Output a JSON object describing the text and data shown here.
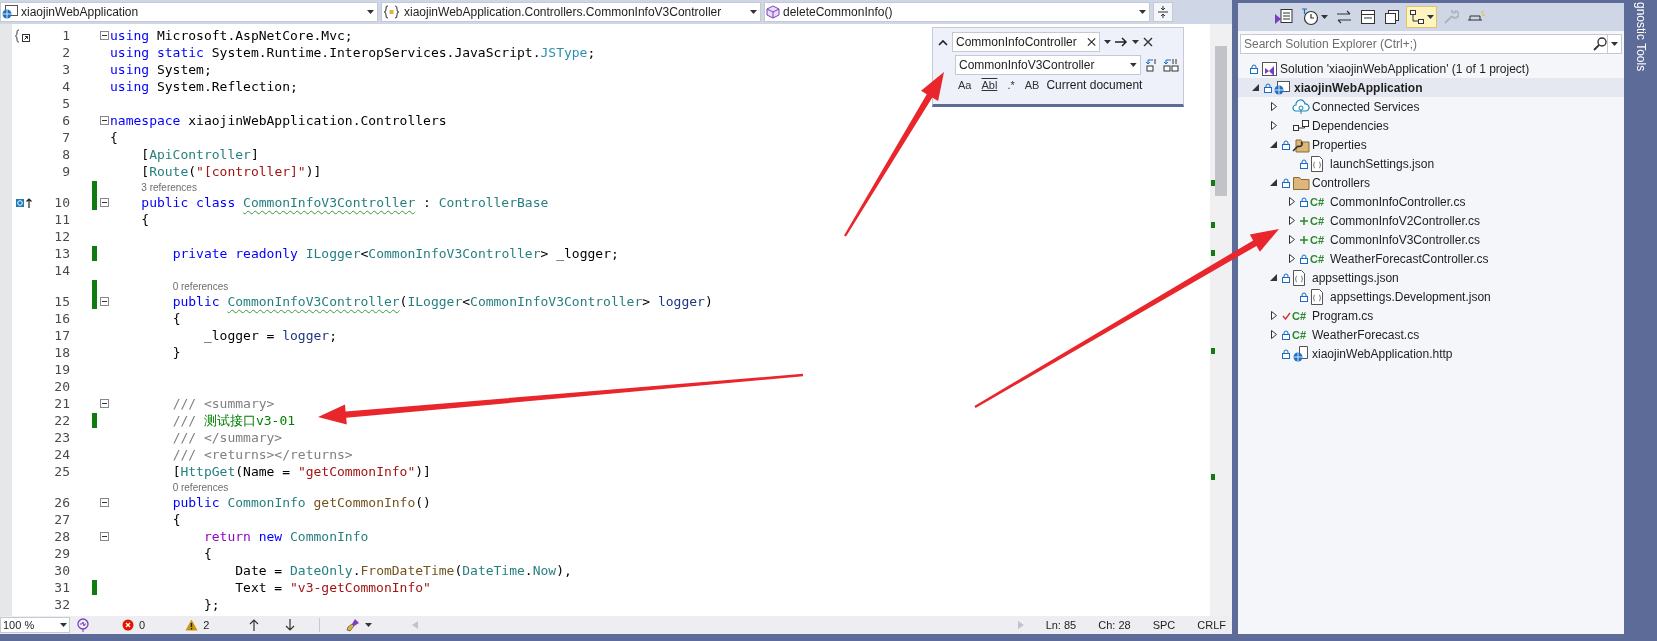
{
  "nav": [
    {
      "kind": "project",
      "text": "xiaojinWebApplication"
    },
    {
      "kind": "namespace",
      "text": "xiaojinWebApplication.Controllers.CommonInfoV3Controller"
    },
    {
      "kind": "method",
      "text": "deleteCommonInfo()"
    }
  ],
  "editor": {
    "lines": [
      {
        "number": "1",
        "kind": "scope",
        "fold": true,
        "changed": false,
        "tokens": [
          {
            "text": "using",
            "kind": "kw"
          },
          {
            "text": " Microsoft.AspNetCore.Mvc;"
          }
        ]
      },
      {
        "number": "2",
        "kind": "code",
        "fold": false,
        "changed": false,
        "tokens": [
          {
            "text": "using",
            "kind": "kw"
          },
          {
            "text": " static",
            "kind": "kw"
          },
          {
            "text": " System.Runtime.InteropServices.JavaScript."
          },
          {
            "text": "JSType",
            "kind": "type2"
          },
          {
            "text": ";"
          }
        ]
      },
      {
        "number": "3",
        "kind": "code",
        "fold": false,
        "changed": false,
        "tokens": [
          {
            "text": "using",
            "kind": "kw"
          },
          {
            "text": " System;"
          }
        ]
      },
      {
        "number": "4",
        "kind": "code",
        "fold": false,
        "changed": false,
        "tokens": [
          {
            "text": "using",
            "kind": "kw"
          },
          {
            "text": " System.Reflection;"
          }
        ]
      },
      {
        "number": "5",
        "kind": "code",
        "fold": false,
        "changed": false
      },
      {
        "number": "6",
        "kind": "code",
        "fold": true,
        "changed": false,
        "tokens": [
          {
            "text": "namespace",
            "kind": "kw"
          },
          {
            "text": " xiaojinWebApplication.Controllers"
          }
        ]
      },
      {
        "number": "7",
        "kind": "code",
        "fold": false,
        "changed": false,
        "tokens": [
          {
            "text": "{"
          }
        ]
      },
      {
        "number": "8",
        "kind": "code",
        "fold": false,
        "changed": false,
        "tokens": [
          {
            "text": "    ["
          },
          {
            "text": "ApiController",
            "kind": "type"
          },
          {
            "text": "]"
          }
        ]
      },
      {
        "number": "9",
        "kind": "code",
        "fold": false,
        "changed": false,
        "tokens": [
          {
            "text": "    ["
          },
          {
            "text": "Route",
            "kind": "type"
          },
          {
            "text": "("
          },
          {
            "text": "\"[controller]\"",
            "kind": "str"
          },
          {
            "text": ")]"
          }
        ]
      },
      {
        "number": "10",
        "kind": "implements",
        "lens": "3 references",
        "fold": true,
        "changed": true,
        "tokens": [
          {
            "text": "    public",
            "kind": "kw"
          },
          {
            "text": " class ",
            "kind": "kw"
          },
          {
            "text": "CommonInfoV3Controller",
            "kind": "type",
            "squiggle": true
          },
          {
            "text": " : "
          },
          {
            "text": "ControllerBase",
            "kind": "type"
          }
        ]
      },
      {
        "number": "11",
        "kind": "code",
        "fold": false,
        "changed": false,
        "tokens": [
          {
            "text": "    {"
          }
        ]
      },
      {
        "number": "12",
        "kind": "code",
        "fold": false,
        "changed": false
      },
      {
        "number": "13",
        "kind": "code",
        "fold": false,
        "changed": true,
        "tokens": [
          {
            "text": "        private",
            "kind": "kw"
          },
          {
            "text": " readonly",
            "kind": "kw"
          },
          {
            "text": " ILogger",
            "kind": "type"
          },
          {
            "text": "<"
          },
          {
            "text": "CommonInfoV3Controller",
            "kind": "type"
          },
          {
            "text": "> _logger;"
          }
        ]
      },
      {
        "number": "14",
        "kind": "code",
        "fold": false,
        "changed": false
      },
      {
        "number": "15",
        "kind": "code",
        "lens": "0 references",
        "fold": true,
        "changed": true,
        "tokens": [
          {
            "text": "        public ",
            "kind": "kw"
          },
          {
            "text": "CommonInfoV3Controller",
            "kind": "type",
            "squiggle": true
          },
          {
            "text": "("
          },
          {
            "text": "ILogger",
            "kind": "type"
          },
          {
            "text": "<"
          },
          {
            "text": "CommonInfoV3Controller",
            "kind": "type"
          },
          {
            "text": "> "
          },
          {
            "text": "logger",
            "kind": "param"
          },
          {
            "text": ")"
          }
        ]
      },
      {
        "number": "16",
        "kind": "code",
        "fold": false,
        "changed": false,
        "tokens": [
          {
            "text": "        {"
          }
        ]
      },
      {
        "number": "17",
        "kind": "code",
        "fold": false,
        "changed": false,
        "tokens": [
          {
            "text": "            _logger = "
          },
          {
            "text": "logger",
            "kind": "param"
          },
          {
            "text": ";"
          }
        ]
      },
      {
        "number": "18",
        "kind": "code",
        "fold": false,
        "changed": false,
        "tokens": [
          {
            "text": "        }"
          }
        ]
      },
      {
        "number": "19",
        "kind": "code",
        "fold": false,
        "changed": false
      },
      {
        "number": "20",
        "kind": "code",
        "fold": false,
        "changed": false
      },
      {
        "number": "21",
        "kind": "code",
        "fold": true,
        "changed": false,
        "tokens": [
          {
            "text": "        /// <summary>",
            "kind": "doc"
          }
        ]
      },
      {
        "number": "22",
        "kind": "code",
        "fold": false,
        "changed": true,
        "tokens": [
          {
            "text": "        ///",
            "kind": "doc"
          },
          {
            "text": " 测试接口v3-01",
            "kind": "com"
          }
        ]
      },
      {
        "number": "23",
        "kind": "code",
        "fold": false,
        "changed": false,
        "tokens": [
          {
            "text": "        /// </summary>",
            "kind": "doc"
          }
        ]
      },
      {
        "number": "24",
        "kind": "code",
        "fold": false,
        "changed": false,
        "tokens": [
          {
            "text": "        /// <returns></returns>",
            "kind": "doc"
          }
        ]
      },
      {
        "number": "25",
        "kind": "code",
        "fold": false,
        "changed": false,
        "tokens": [
          {
            "text": "        ["
          },
          {
            "text": "HttpGet",
            "kind": "type"
          },
          {
            "text": "(Name = "
          },
          {
            "text": "\"getCommonInfo\"",
            "kind": "str"
          },
          {
            "text": ")]"
          }
        ]
      },
      {
        "number": "26",
        "kind": "code",
        "lens": "0 references",
        "fold": true,
        "changed": false,
        "tokens": [
          {
            "text": "        public",
            "kind": "kw"
          },
          {
            "text": " CommonInfo",
            "kind": "type"
          },
          {
            "text": " getCommonInfo",
            "kind": "method"
          },
          {
            "text": "()"
          }
        ]
      },
      {
        "number": "27",
        "kind": "code",
        "fold": false,
        "changed": false,
        "tokens": [
          {
            "text": "        {"
          }
        ]
      },
      {
        "number": "28",
        "kind": "code",
        "fold": true,
        "changed": false,
        "tokens": [
          {
            "text": "            return",
            "kind": "ctl"
          },
          {
            "text": " new",
            "kind": "kw"
          },
          {
            "text": " CommonInfo",
            "kind": "type"
          }
        ]
      },
      {
        "number": "29",
        "kind": "code",
        "fold": false,
        "changed": false,
        "tokens": [
          {
            "text": "            {"
          }
        ]
      },
      {
        "number": "30",
        "kind": "code",
        "fold": false,
        "changed": false,
        "tokens": [
          {
            "text": "                Date = "
          },
          {
            "text": "DateOnly",
            "kind": "type"
          },
          {
            "text": "."
          },
          {
            "text": "FromDateTime",
            "kind": "method"
          },
          {
            "text": "("
          },
          {
            "text": "DateTime",
            "kind": "type"
          },
          {
            "text": "."
          },
          {
            "text": "Now",
            "kind": "type"
          },
          {
            "text": "),"
          }
        ]
      },
      {
        "number": "31",
        "kind": "code",
        "fold": false,
        "changed": true,
        "tokens": [
          {
            "text": "                Text = "
          },
          {
            "text": "\"v3-getCommonInfo\"",
            "kind": "str"
          }
        ]
      },
      {
        "number": "32",
        "kind": "code",
        "fold": false,
        "changed": false,
        "tokens": [
          {
            "text": "            };"
          }
        ]
      }
    ]
  },
  "find_widget": {
    "find": {
      "value": "CommonInfoController"
    },
    "replace": {
      "value": "CommonInfoV3Controller"
    },
    "options": [
      {
        "label": "Aa",
        "selected": false
      },
      {
        "label": "Abl",
        "selected": false
      },
      {
        "label": ".*",
        "selected": false
      },
      {
        "label": "AB",
        "selected": false
      }
    ],
    "scope": "Current document"
  },
  "status_bar": {
    "zoom": "100 %",
    "errors": "0",
    "warnings": "2",
    "line": "Ln: 85",
    "column": "Ch: 28",
    "indent": "SPC",
    "line_ending": "CRLF"
  },
  "solution_explorer": {
    "toolbar": [
      {
        "kind": "switch-views",
        "selected": false,
        "disabled": false
      },
      {
        "kind": "history",
        "dropdown": true,
        "selected": false,
        "disabled": false
      },
      {
        "kind": "sync",
        "selected": false,
        "disabled": false
      },
      {
        "kind": "collapse",
        "selected": false,
        "disabled": false
      },
      {
        "kind": "show-all",
        "selected": false,
        "disabled": false
      },
      {
        "kind": "preview",
        "dropdown": true,
        "selected": true,
        "disabled": false
      },
      {
        "kind": "properties",
        "selected": false,
        "disabled": true
      },
      {
        "kind": "pending",
        "selected": false,
        "disabled": false
      }
    ],
    "search": {
      "placeholder": "Search Solution Explorer (Ctrl+;)"
    },
    "tree": [
      {
        "label": "Solution 'xiaojinWebApplication' (1 of 1 project)",
        "kind": "solution",
        "locked": true,
        "added": false,
        "modified": false,
        "selected": false,
        "children": [
          {
            "label": "xiaojinWebApplication",
            "kind": "project",
            "locked": true,
            "added": false,
            "modified": false,
            "expanded": true,
            "selected": true,
            "children": [
              {
                "label": "Connected Services",
                "kind": "connected",
                "locked": false,
                "added": false,
                "modified": false,
                "expanded": false,
                "selected": false
              },
              {
                "label": "Dependencies",
                "kind": "dependencies",
                "locked": false,
                "added": false,
                "modified": false,
                "expanded": false,
                "selected": false
              },
              {
                "label": "Properties",
                "kind": "properties",
                "locked": true,
                "added": false,
                "modified": false,
                "expanded": true,
                "selected": false,
                "children": [
                  {
                    "label": "launchSettings.json",
                    "kind": "json",
                    "locked": true,
                    "added": false,
                    "modified": false,
                    "selected": false
                  }
                ]
              },
              {
                "label": "Controllers",
                "kind": "folder",
                "locked": true,
                "added": false,
                "modified": false,
                "expanded": true,
                "selected": false,
                "children": [
                  {
                    "label": "CommonInfoController.cs",
                    "kind": "csharp",
                    "icon_label": "C#",
                    "locked": true,
                    "added": false,
                    "modified": false,
                    "expanded": false,
                    "selected": false
                  },
                  {
                    "label": "CommonInfoV2Controller.cs",
                    "kind": "csharp",
                    "icon_label": "C#",
                    "locked": false,
                    "added": true,
                    "modified": false,
                    "expanded": false,
                    "selected": false
                  },
                  {
                    "label": "CommonInfoV3Controller.cs",
                    "kind": "csharp",
                    "icon_label": "C#",
                    "locked": false,
                    "added": true,
                    "modified": false,
                    "expanded": false,
                    "selected": false
                  },
                  {
                    "label": "WeatherForecastController.cs",
                    "kind": "csharp",
                    "icon_label": "C#",
                    "locked": true,
                    "added": false,
                    "modified": false,
                    "expanded": false,
                    "selected": false
                  }
                ]
              },
              {
                "label": "appsettings.json",
                "kind": "json",
                "locked": true,
                "added": false,
                "modified": false,
                "expanded": true,
                "selected": false,
                "children": [
                  {
                    "label": "appsettings.Development.json",
                    "kind": "json",
                    "locked": true,
                    "added": false,
                    "modified": false,
                    "selected": false
                  }
                ]
              },
              {
                "label": "Program.cs",
                "kind": "csharp",
                "icon_label": "C#",
                "locked": false,
                "added": false,
                "modified": true,
                "expanded": false,
                "selected": false
              },
              {
                "label": "WeatherForecast.cs",
                "kind": "csharp",
                "icon_label": "C#",
                "locked": true,
                "added": false,
                "modified": false,
                "expanded": false,
                "selected": false
              },
              {
                "label": "xiaojinWebApplication.http",
                "kind": "http",
                "locked": true,
                "added": false,
                "modified": false,
                "selected": false
              }
            ]
          }
        ]
      }
    ]
  },
  "side_tab": {
    "label": "gnostic Tools"
  }
}
